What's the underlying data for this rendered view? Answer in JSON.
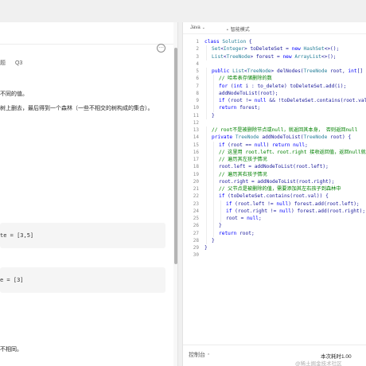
{
  "problem": {
    "more_label": "⋯",
    "tag_prefix": "题",
    "tag_q": "Q3",
    "desc_line1": "不同的值。",
    "desc_line2": "树上删去，最后得到一个森林（一些不相交的树构成的集合）。",
    "example1_text": "te = [3,5]",
    "example2_text": "e = [3]",
    "footer_line": "不相同。"
  },
  "editor": {
    "language": "Java",
    "language_chevron": "⌄",
    "smart_mode_dot": "•",
    "smart_mode": "智能模式",
    "lines": [
      {
        "n": "1",
        "indent": 0,
        "text": "class Solution {"
      },
      {
        "n": "2",
        "indent": 1,
        "text": "Set<Integer> toDeleteSet = new HashSet<>();"
      },
      {
        "n": "3",
        "indent": 1,
        "text": "List<TreeNode> forest = new ArrayList<>();"
      },
      {
        "n": "4",
        "indent": 0,
        "text": ""
      },
      {
        "n": "5",
        "indent": 1,
        "text": "public List<TreeNode> delNodes(TreeNode root, int[] to_d"
      },
      {
        "n": "6",
        "indent": 2,
        "text": "// 哈希表存储删除的数"
      },
      {
        "n": "7",
        "indent": 2,
        "text": "for (int i : to_delete) toDeleteSet.add(i);"
      },
      {
        "n": "8",
        "indent": 2,
        "text": "addNodeToList(root);"
      },
      {
        "n": "9",
        "indent": 2,
        "text": "if (root != null && !toDeleteSet.contains(root.val)) f"
      },
      {
        "n": "10",
        "indent": 2,
        "text": "return forest;"
      },
      {
        "n": "11",
        "indent": 1,
        "text": "}"
      },
      {
        "n": "12",
        "indent": 0,
        "text": ""
      },
      {
        "n": "13",
        "indent": 1,
        "text": "// root不是被删除节点或null，就返回其本身， 否则返回null"
      },
      {
        "n": "14",
        "indent": 1,
        "text": "private TreeNode addNodeToList(TreeNode root) {"
      },
      {
        "n": "15",
        "indent": 2,
        "text": "if (root == null) return null;"
      },
      {
        "n": "16",
        "indent": 2,
        "text": "// 这里用 root.left、root.right 接收返回值，返回null就"
      },
      {
        "n": "17",
        "indent": 2,
        "text": "// 遍历其左孩子情况"
      },
      {
        "n": "18",
        "indent": 2,
        "text": "root.left = addNodeToList(root.left);"
      },
      {
        "n": "19",
        "indent": 2,
        "text": "// 遍历其右孩子情况"
      },
      {
        "n": "20",
        "indent": 2,
        "text": "root.right = addNodeToList(root.right);"
      },
      {
        "n": "21",
        "indent": 2,
        "text": "// 父节点是被删除的值，需要添加其左右孩子到森林中"
      },
      {
        "n": "22",
        "indent": 2,
        "text": "if (toDeleteSet.contains(root.val)) {"
      },
      {
        "n": "23",
        "indent": 3,
        "text": "if (root.left != null) forest.add(root.left);"
      },
      {
        "n": "24",
        "indent": 3,
        "text": "if (root.right != null) forest.add(root.right);"
      },
      {
        "n": "25",
        "indent": 3,
        "text": "root = null;"
      },
      {
        "n": "26",
        "indent": 2,
        "text": "}"
      },
      {
        "n": "27",
        "indent": 2,
        "text": "return root;"
      },
      {
        "n": "28",
        "indent": 1,
        "text": "}"
      },
      {
        "n": "29",
        "indent": 0,
        "text": "}"
      },
      {
        "n": "30",
        "indent": 0,
        "text": ""
      }
    ]
  },
  "bottom": {
    "console_label": "控制台",
    "console_chevron": "⌃",
    "status": "本次耗时1.00",
    "watermark": "@稀土掘金技术社区"
  },
  "colors": {
    "keyword": "#0000ff",
    "type": "#267f99",
    "comment": "#008000",
    "text": "#1a1a9a"
  }
}
